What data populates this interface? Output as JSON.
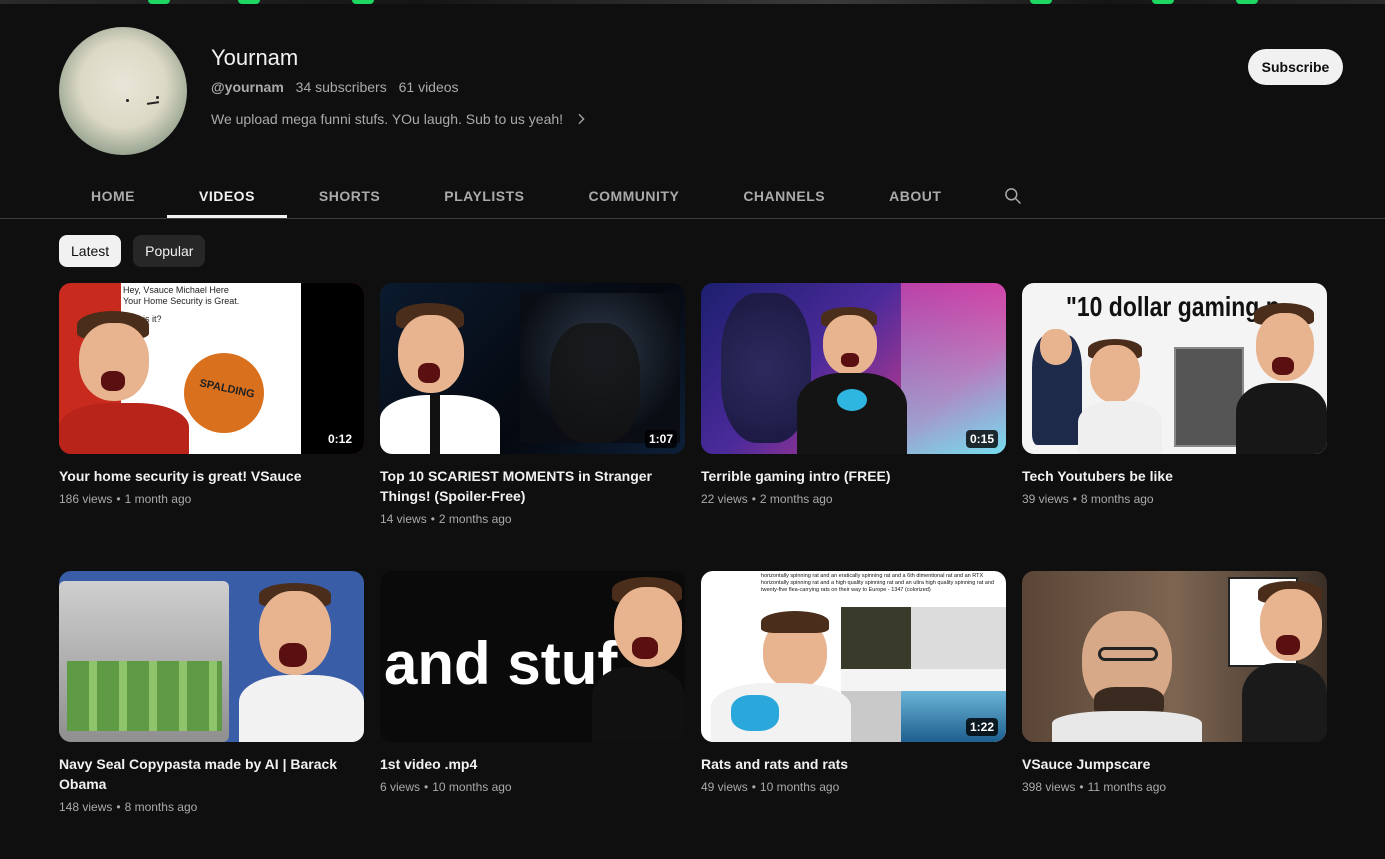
{
  "channel": {
    "name": "Yournam",
    "handle": "@yournam",
    "subscribers": "34 subscribers",
    "videos": "61 videos",
    "description": "We upload mega funni stufs. YOu laugh. Sub to us yeah!",
    "subscribe_label": "Subscribe"
  },
  "tabs": [
    {
      "label": "HOME"
    },
    {
      "label": "VIDEOS"
    },
    {
      "label": "SHORTS"
    },
    {
      "label": "PLAYLISTS"
    },
    {
      "label": "COMMUNITY"
    },
    {
      "label": "CHANNELS"
    },
    {
      "label": "ABOUT"
    }
  ],
  "active_tab": "VIDEOS",
  "chips": [
    {
      "label": "Latest"
    },
    {
      "label": "Popular"
    }
  ],
  "thumbnail_text": {
    "security": "Hey, Vsauce Michael Here\nYour Home Security is Great.",
    "security_2": "is it?",
    "ball": "SPALDING",
    "gaming": "\"10 dollar gaming p",
    "stuff": "and stuf",
    "rats": "horizontally spinning rat and an eratically spinning rat and a 6th dimentional rat and an RTX horizontally spinning rat and a high quality spinning rat and an ultra high quality spinning rat and twenty-five flea-carrying rats on their way to Europe - 1347 (colorized)"
  },
  "videos": [
    {
      "title": "Your home security is great! VSauce",
      "views": "186 views",
      "age": "1 month ago",
      "duration": "0:12"
    },
    {
      "title": "Top 10 SCARIEST MOMENTS in Stranger Things! (Spoiler-Free)",
      "views": "14 views",
      "age": "2 months ago",
      "duration": "1:07"
    },
    {
      "title": "Terrible gaming intro (FREE)",
      "views": "22 views",
      "age": "2 months ago",
      "duration": "0:15"
    },
    {
      "title": "Tech Youtubers be like",
      "views": "39 views",
      "age": "8 months ago",
      "duration": ""
    },
    {
      "title": "Navy Seal Copypasta made by AI | Barack Obama",
      "views": "148 views",
      "age": "8 months ago",
      "duration": ""
    },
    {
      "title": "1st video .mp4",
      "views": "6 views",
      "age": "10 months ago",
      "duration": ""
    },
    {
      "title": "Rats and rats and rats",
      "views": "49 views",
      "age": "10 months ago",
      "duration": "1:22"
    },
    {
      "title": "VSauce Jumpscare",
      "views": "398 views",
      "age": "11 months ago",
      "duration": ""
    }
  ],
  "icons": {
    "search": "search-icon",
    "chevron": "chevron-right-icon"
  }
}
